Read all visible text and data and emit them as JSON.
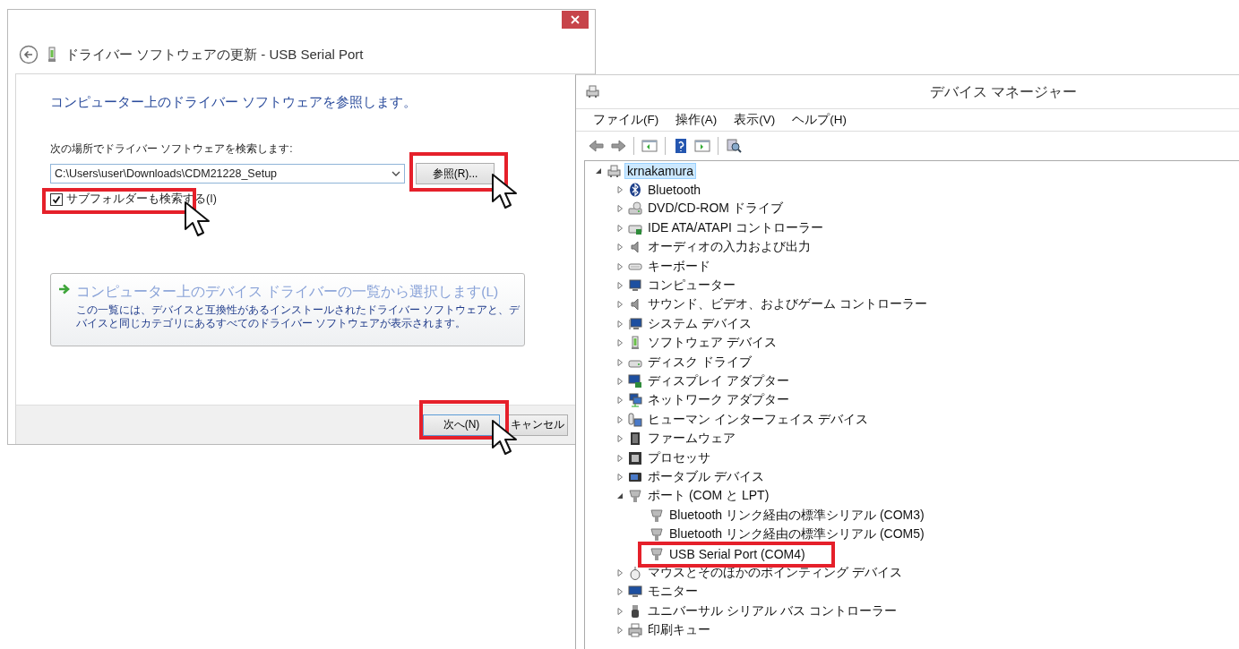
{
  "driver_dialog": {
    "title": "ドライバー ソフトウェアの更新 - USB Serial Port",
    "heading": "コンピューター上のドライバー ソフトウェアを参照します。",
    "search_label": "次の場所でドライバー ソフトウェアを検索します:",
    "path_field": {
      "value": "C:\\Users\\user\\Downloads\\CDM21228_Setup"
    },
    "browse_button": "参照(R)...",
    "subfolder_checkbox": {
      "label": "サブフォルダーも検索する(I)",
      "checked": true
    },
    "pick_option": {
      "title": "コンピューター上のデバイス ドライバーの一覧から選択します(L)",
      "description": "この一覧には、デバイスと互換性があるインストールされたドライバー ソフトウェアと、デバイスと同じカテゴリにあるすべてのドライバー ソフトウェアが表示されます。"
    },
    "buttons": [
      "次へ(N)",
      "キャンセル"
    ]
  },
  "device_manager": {
    "title": "デバイス マネージャー",
    "menu": [
      "ファイル(F)",
      "操作(A)",
      "表示(V)",
      "ヘルプ(H)"
    ],
    "tree": [
      {
        "label": "krnakamura",
        "expanded": true,
        "selected": true,
        "children": [
          {
            "label": "Bluetooth",
            "expanded": false,
            "selected": false
          },
          {
            "label": "DVD/CD-ROM ドライブ",
            "expanded": false,
            "selected": false
          },
          {
            "label": "IDE ATA/ATAPI コントローラー",
            "expanded": false,
            "selected": false
          },
          {
            "label": "オーディオの入力および出力",
            "expanded": false,
            "selected": false
          },
          {
            "label": "キーボード",
            "expanded": false,
            "selected": false
          },
          {
            "label": "コンピューター",
            "expanded": false,
            "selected": false
          },
          {
            "label": "サウンド、ビデオ、およびゲーム コントローラー",
            "expanded": false,
            "selected": false
          },
          {
            "label": "システム デバイス",
            "expanded": false,
            "selected": false
          },
          {
            "label": "ソフトウェア デバイス",
            "expanded": false,
            "selected": false
          },
          {
            "label": "ディスク ドライブ",
            "expanded": false,
            "selected": false
          },
          {
            "label": "ディスプレイ アダプター",
            "expanded": false,
            "selected": false
          },
          {
            "label": "ネットワーク アダプター",
            "expanded": false,
            "selected": false
          },
          {
            "label": "ヒューマン インターフェイス デバイス",
            "expanded": false,
            "selected": false
          },
          {
            "label": "ファームウェア",
            "expanded": false,
            "selected": false
          },
          {
            "label": "プロセッサ",
            "expanded": false,
            "selected": false
          },
          {
            "label": "ポータブル デバイス",
            "expanded": false,
            "selected": false
          },
          {
            "label": "ポート (COM と LPT)",
            "expanded": true,
            "selected": false,
            "children": [
              {
                "label": "Bluetooth リンク経由の標準シリアル (COM3)",
                "selected": false
              },
              {
                "label": "Bluetooth リンク経由の標準シリアル (COM5)",
                "selected": false
              },
              {
                "label": "USB Serial Port (COM4)",
                "selected": false
              }
            ]
          },
          {
            "label": "マウスとそのほかのポインティング デバイス",
            "expanded": false,
            "selected": false
          },
          {
            "label": "モニター",
            "expanded": false,
            "selected": false
          },
          {
            "label": "ユニバーサル シリアル バス コントローラー",
            "expanded": false,
            "selected": false
          },
          {
            "label": "印刷キュー",
            "expanded": false,
            "selected": false
          }
        ]
      }
    ]
  }
}
